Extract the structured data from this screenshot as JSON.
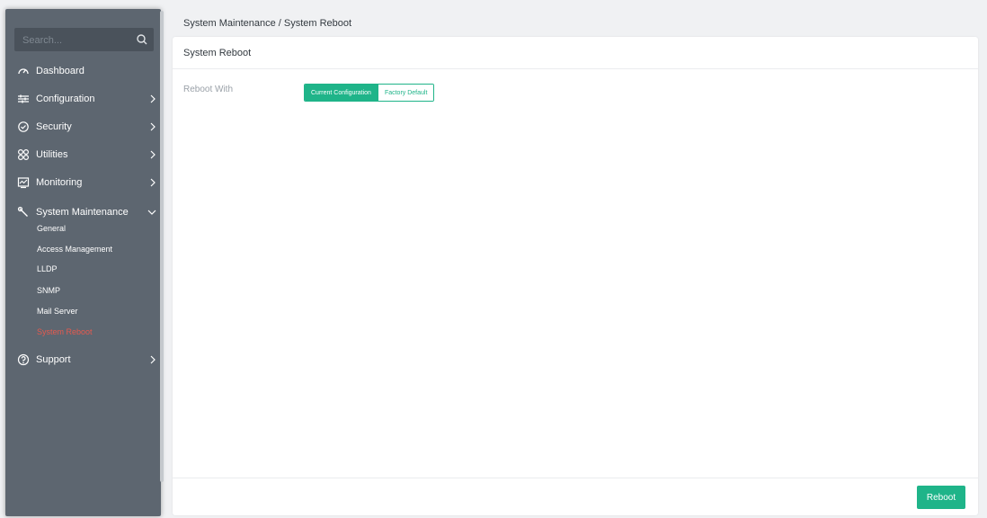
{
  "sidebar": {
    "search_placeholder": "Search...",
    "items": [
      {
        "label": "Dashboard",
        "icon": "dashboard-icon"
      },
      {
        "label": "Configuration",
        "icon": "sliders-icon"
      },
      {
        "label": "Security",
        "icon": "shield-icon"
      },
      {
        "label": "Utilities",
        "icon": "grid-icon"
      },
      {
        "label": "Monitoring",
        "icon": "monitor-icon"
      },
      {
        "label": "System Maintenance",
        "icon": "wrench-icon"
      },
      {
        "label": "Support",
        "icon": "help-icon"
      }
    ],
    "sub_items": [
      "General",
      "Access Management",
      "LLDP",
      "SNMP",
      "Mail Server",
      "System Reboot"
    ],
    "active_sub_item": "System Reboot"
  },
  "breadcrumb": {
    "text": "System Maintenance / System Reboot"
  },
  "panel": {
    "title": "System Reboot",
    "reboot_with_label": "Reboot With",
    "options": [
      "Current Configuration",
      "Factory Default"
    ],
    "selected_option": "Current Configuration",
    "reboot_button": "Reboot"
  },
  "colors": {
    "accent": "#1fb489",
    "sidebar_bg": "#5d6670",
    "active_sub": "#e55a4f"
  }
}
